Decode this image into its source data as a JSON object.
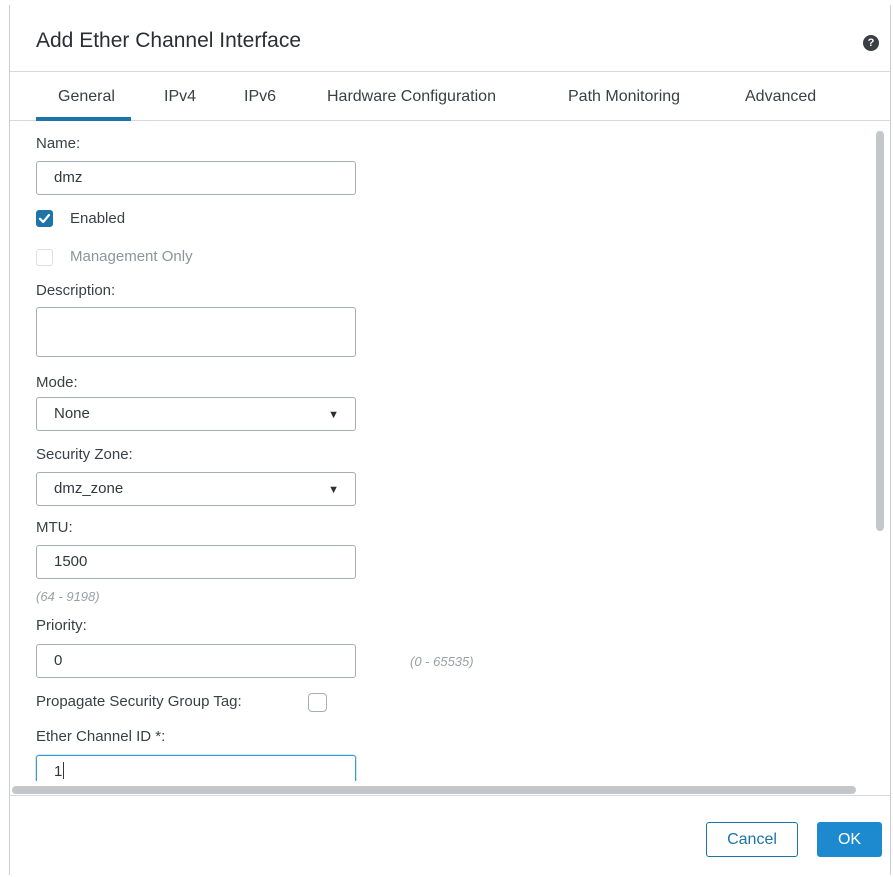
{
  "dialog": {
    "title": "Add Ether Channel Interface",
    "help_icon": "?"
  },
  "tabs": [
    {
      "label": "General",
      "active": true
    },
    {
      "label": "IPv4"
    },
    {
      "label": "IPv6"
    },
    {
      "label": "Hardware Configuration"
    },
    {
      "label": "Path Monitoring"
    },
    {
      "label": "Advanced"
    }
  ],
  "form": {
    "name_label": "Name:",
    "name_value": "dmz",
    "enabled_label": "Enabled",
    "enabled_checked": true,
    "management_only_label": "Management Only",
    "management_only_checked": false,
    "description_label": "Description:",
    "description_value": "",
    "mode_label": "Mode:",
    "mode_value": "None",
    "security_zone_label": "Security Zone:",
    "security_zone_value": "dmz_zone",
    "mtu_label": "MTU:",
    "mtu_value": "1500",
    "mtu_hint": "(64 - 9198)",
    "priority_label": "Priority:",
    "priority_value": "0",
    "priority_hint": "(0 - 65535)",
    "sgt_label": "Propagate Security Group Tag:",
    "sgt_checked": false,
    "ether_channel_id_label": "Ether Channel ID *:",
    "ether_channel_id_value": "1"
  },
  "buttons": {
    "cancel": "Cancel",
    "ok": "OK"
  },
  "colors": {
    "accent": "#1d74a8",
    "ok_button": "#1d8ad0"
  },
  "icons": {
    "help": "question-circle-icon",
    "checkbox": "checkmark-icon",
    "dropdown": "caret-down-icon"
  }
}
